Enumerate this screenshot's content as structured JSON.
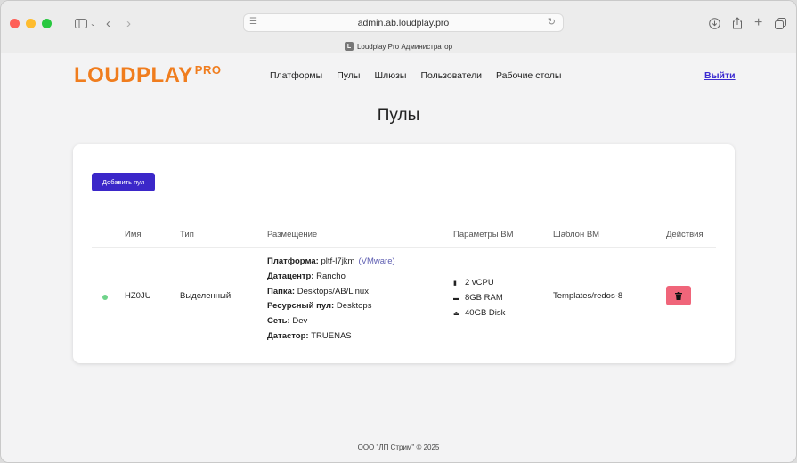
{
  "browser": {
    "url": "admin.ab.loudplay.pro",
    "tab_title": "Loudplay Pro Администратор",
    "tab_favicon_letter": "L"
  },
  "header": {
    "logo_text": "LOUDPLAY",
    "logo_sup": "PRO",
    "nav": [
      "Платформы",
      "Пулы",
      "Шлюзы",
      "Пользователи",
      "Рабочие столы"
    ],
    "logout": "Выйти"
  },
  "main": {
    "title": "Пулы",
    "add_button": "Добавить пул",
    "columns": [
      "Имя",
      "Тип",
      "Размещение",
      "Параметры ВМ",
      "Шаблон ВМ",
      "Действия"
    ],
    "rows": [
      {
        "status_color": "#6fd38a",
        "name": "HZ0JU",
        "type": "Выделенный",
        "placement": {
          "platform_label": "Платформа:",
          "platform": "pltf-l7jkm",
          "platform_type": "(VMware)",
          "datacenter_label": "Датацентр:",
          "datacenter": "Rancho",
          "folder_label": "Папка:",
          "folder": "Desktops/AB/Linux",
          "pool_label": "Ресурсный пул:",
          "pool": "Desktops",
          "network_label": "Сеть:",
          "network": "Dev",
          "datastore_label": "Датастор:",
          "datastore": "TRUENAS"
        },
        "params": [
          "2 vCPU",
          "8GB RAM",
          "40GB Disk"
        ],
        "template": "Templates/redos-8"
      }
    ]
  },
  "footer": "ООО \"ЛП Стрим\" © 2025",
  "colors": {
    "brand": "#f07d1e",
    "primary_button": "#3b27c9",
    "delete_button": "#f0657a"
  }
}
